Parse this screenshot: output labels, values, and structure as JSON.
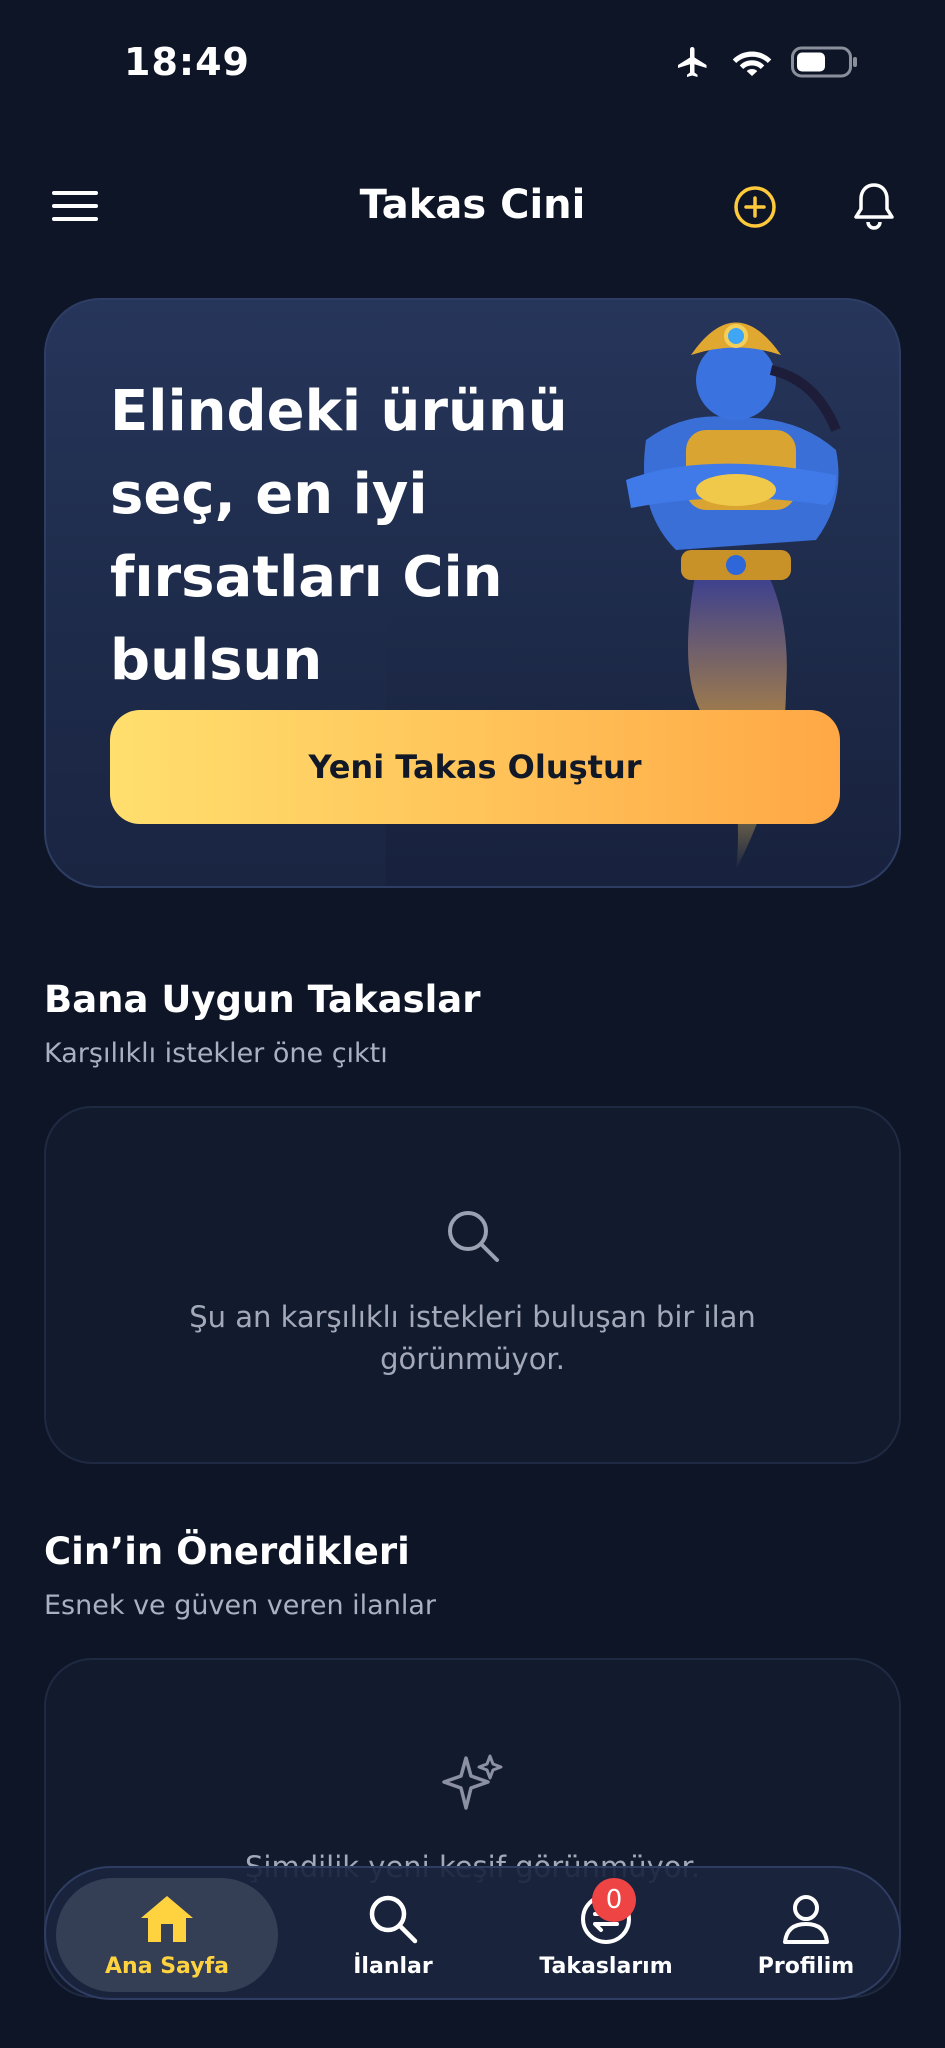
{
  "status_bar": {
    "time": "18:49"
  },
  "header": {
    "title": "Takas Cini"
  },
  "hero": {
    "title": "Elindeki ürünü seç, en iyi fırsatları Cin bulsun",
    "cta_label": "Yeni Takas Oluştur"
  },
  "matching_section": {
    "title": "Bana Uygun Takaslar",
    "subtitle": "Karşılıklı istekler öne çıktı",
    "empty_text": "Şu an karşılıklı istekleri buluşan bir ilan görünmüyor."
  },
  "suggestions_section": {
    "title": "Cin’in Önerdikleri",
    "subtitle": "Esnek ve güven veren ilanlar",
    "empty_text": "Şimdilik yeni keşif görünmüyor."
  },
  "bottom_nav": {
    "items": [
      {
        "label": "Ana Sayfa",
        "icon": "home-icon",
        "active": true
      },
      {
        "label": "İlanlar",
        "icon": "search-icon",
        "active": false
      },
      {
        "label": "Takaslarım",
        "icon": "swap-icon",
        "active": false,
        "badge": "0"
      },
      {
        "label": "Profilim",
        "icon": "user-icon",
        "active": false
      }
    ]
  },
  "colors": {
    "background": "#0e1527",
    "accent": "#ffd23f",
    "cta_gradient_start": "#ffdf6e",
    "cta_gradient_end": "#ffa845",
    "badge": "#ef4444"
  }
}
